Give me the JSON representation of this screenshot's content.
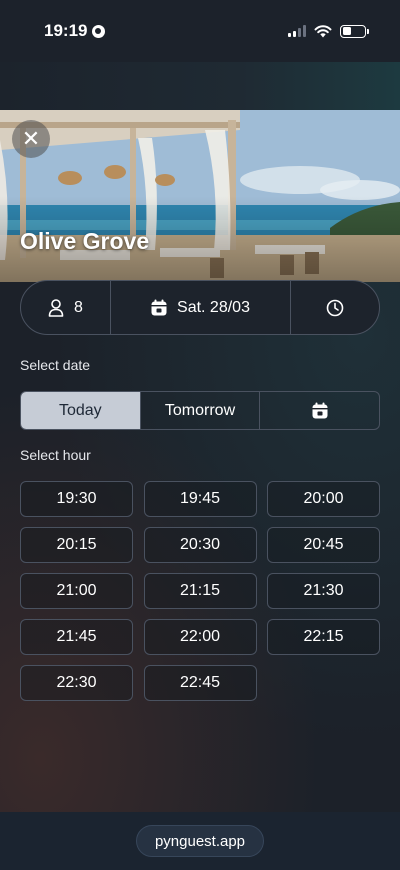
{
  "status_bar": {
    "time": "19:19"
  },
  "restaurant": {
    "name": "Olive Grove"
  },
  "booking_bar": {
    "guests": "8",
    "date": "Sat. 28/03"
  },
  "select_date": {
    "label": "Select date",
    "tabs": [
      {
        "label": "Today",
        "active": true
      },
      {
        "label": "Tomorrow",
        "active": false
      }
    ]
  },
  "select_hour": {
    "label": "Select hour",
    "slots": [
      "19:30",
      "19:45",
      "20:00",
      "20:15",
      "20:30",
      "20:45",
      "21:00",
      "21:15",
      "21:30",
      "21:45",
      "22:00",
      "22:15",
      "22:30",
      "22:45"
    ]
  },
  "footer": {
    "link": "pynguest.app"
  },
  "icons": [
    "globe-icon",
    "signal-icon",
    "wifi-icon",
    "battery-icon",
    "close-icon",
    "person-icon",
    "calendar-icon",
    "clock-icon"
  ]
}
